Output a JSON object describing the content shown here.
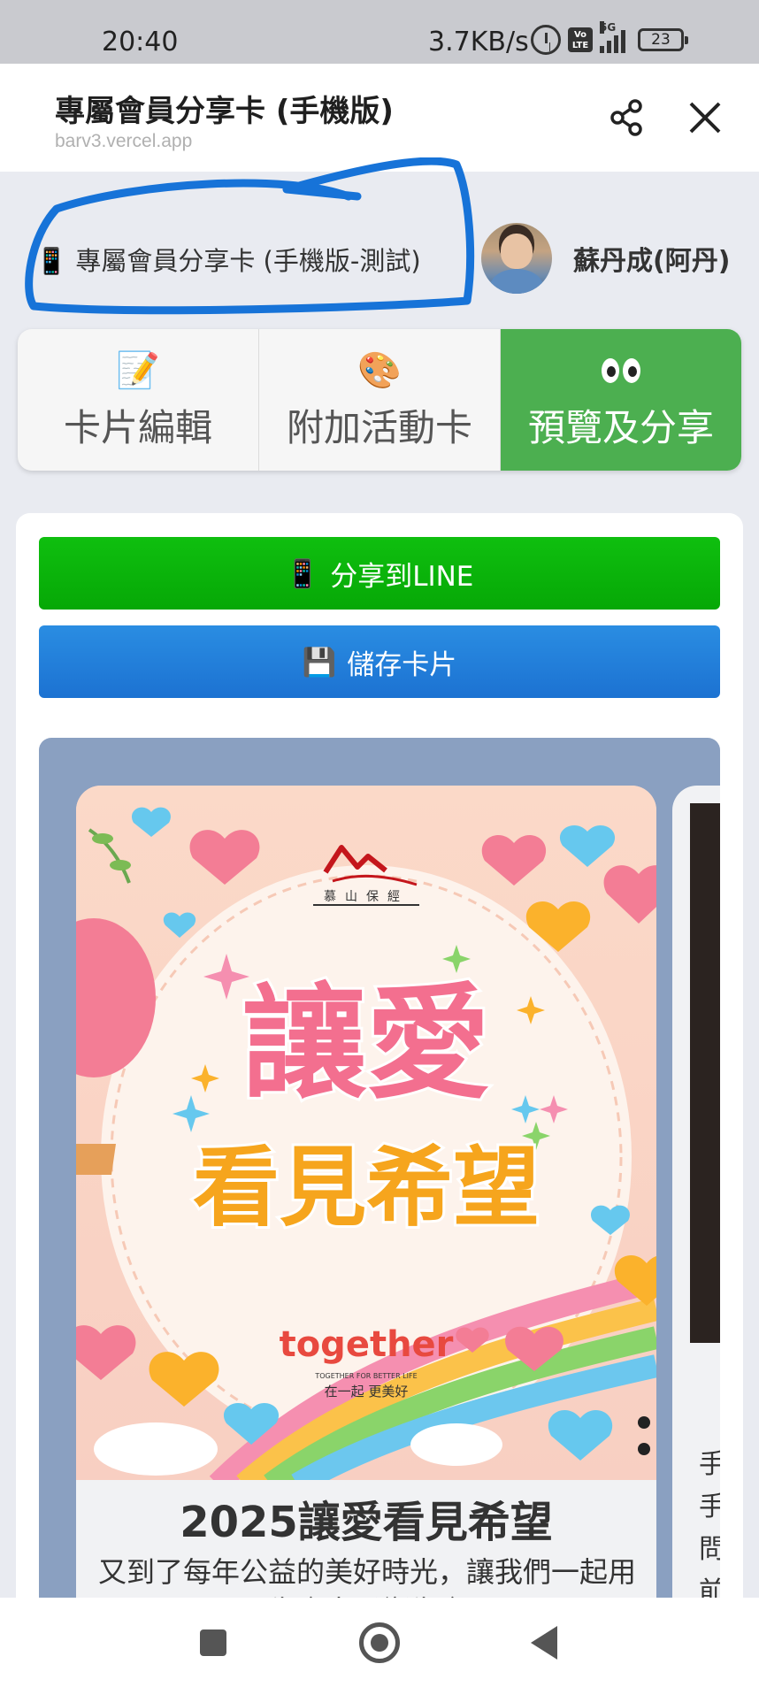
{
  "status_bar": {
    "time": "20:40",
    "network_speed": "3.7KB/s",
    "network_type": "5G",
    "volte": "Vo LTE",
    "battery": "23"
  },
  "app_bar": {
    "title": "專屬會員分享卡 (手機版)",
    "url": "barv3.vercel.app",
    "share_icon": "share-icon",
    "close_icon": "close-icon"
  },
  "page_header": {
    "icon": "📱",
    "label": "專屬會員分享卡 (手機版-測試)",
    "user_name": "蘇丹成(阿丹)",
    "annotation_color": "#1a73e8"
  },
  "tabs": [
    {
      "icon": "📝",
      "label": "卡片編輯",
      "active": false
    },
    {
      "icon": "🎨",
      "label": "附加活動卡",
      "active": false
    },
    {
      "icon": "👀",
      "label": "預覽及分享",
      "active": true
    }
  ],
  "actions": {
    "share_line_icon": "📱",
    "share_line_label": "分享到LINE",
    "save_icon": "💾",
    "save_label": "儲存卡片"
  },
  "poster": {
    "logo_text": "慕山保經",
    "headline_top": "讓愛",
    "headline_bottom": "看見希望",
    "brand": "together",
    "brand_tagline": "TOGETHER FOR BETTER LIFE",
    "brand_slogan": "在一起 更美好",
    "title": "2025讓愛看見希望",
    "description": "又到了每年公益的美好時光，讓我們一起用生命去影響生命"
  },
  "next_card": {
    "text": "手\n手\n問\n前"
  },
  "colors": {
    "active_tab": "#4caf50",
    "line_button": "#0fbf0f",
    "save_button": "#1c72d2",
    "carousel_bg": "#8aa0c1"
  }
}
